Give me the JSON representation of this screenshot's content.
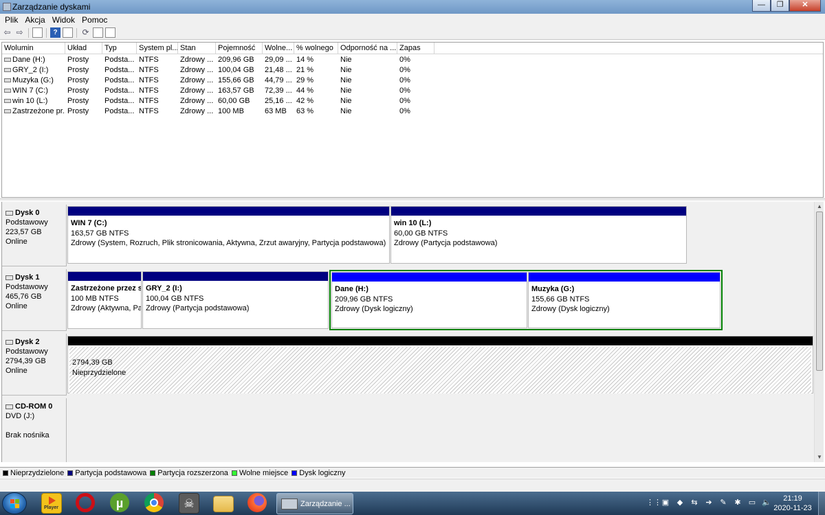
{
  "window": {
    "title": "Zarządzanie dyskami",
    "minimize": "—",
    "maximize": "❐",
    "close": "✕"
  },
  "menu": [
    "Plik",
    "Akcja",
    "Widok",
    "Pomoc"
  ],
  "toolbar": {
    "icons": [
      "back-icon",
      "forward-icon",
      "console-tree-icon",
      "help-icon",
      "list-view-icon",
      "refresh-icon",
      "properties-icon",
      "settings-icon"
    ],
    "back": "⇦",
    "forward": "⇨",
    "help": "?",
    "refresh": "⟳"
  },
  "columns": [
    "Wolumin",
    "Układ",
    "Typ",
    "System pl...",
    "Stan",
    "Pojemność",
    "Wolne...",
    "% wolnego",
    "Odporność na ...",
    "Zapas"
  ],
  "volumes": [
    [
      "Dane (H:)",
      "Prosty",
      "Podsta...",
      "NTFS",
      "Zdrowy ...",
      "209,96 GB",
      "29,09 ...",
      "14 %",
      "Nie",
      "0%"
    ],
    [
      "GRY_2 (I:)",
      "Prosty",
      "Podsta...",
      "NTFS",
      "Zdrowy ...",
      "100,04 GB",
      "21,48 ...",
      "21 %",
      "Nie",
      "0%"
    ],
    [
      "Muzyka (G:)",
      "Prosty",
      "Podsta...",
      "NTFS",
      "Zdrowy ...",
      "155,66 GB",
      "44,79 ...",
      "29 %",
      "Nie",
      "0%"
    ],
    [
      "WIN 7 (C:)",
      "Prosty",
      "Podsta...",
      "NTFS",
      "Zdrowy ...",
      "163,57 GB",
      "72,39 ...",
      "44 %",
      "Nie",
      "0%"
    ],
    [
      "win 10 (L:)",
      "Prosty",
      "Podsta...",
      "NTFS",
      "Zdrowy ...",
      "60,00 GB",
      "25,16 ...",
      "42 %",
      "Nie",
      "0%"
    ],
    [
      "Zastrzeżone pr...",
      "Prosty",
      "Podsta...",
      "NTFS",
      "Zdrowy ...",
      "100 MB",
      "63 MB",
      "63 %",
      "Nie",
      "0%"
    ]
  ],
  "disks": {
    "disk0": {
      "name": "Dysk 0",
      "type": "Podstawowy",
      "size": "223,57 GB",
      "status": "Online",
      "parts": [
        {
          "name": "WIN 7  (C:)",
          "size": "163,57 GB NTFS",
          "status": "Zdrowy (System, Rozruch, Plik stronicowania, Aktywna, Zrzut awaryjny, Partycja podstawowa)"
        },
        {
          "name": "win 10  (L:)",
          "size": "60,00 GB NTFS",
          "status": "Zdrowy (Partycja podstawowa)"
        }
      ]
    },
    "disk1": {
      "name": "Dysk 1",
      "type": "Podstawowy",
      "size": "465,76 GB",
      "status": "Online",
      "parts": [
        {
          "name": "Zastrzeżone przez s",
          "size": "100 MB NTFS",
          "status": "Zdrowy (Aktywna, Pa"
        },
        {
          "name": "GRY_2  (I:)",
          "size": "100,04 GB NTFS",
          "status": "Zdrowy (Partycja podstawowa)"
        },
        {
          "name": "Dane  (H:)",
          "size": "209,96 GB NTFS",
          "status": "Zdrowy (Dysk logiczny)"
        },
        {
          "name": "Muzyka  (G:)",
          "size": "155,66 GB NTFS",
          "status": "Zdrowy (Dysk logiczny)"
        }
      ]
    },
    "disk2": {
      "name": "Dysk 2",
      "type": "Podstawowy",
      "size": "2794,39 GB",
      "status": "Online",
      "parts": [
        {
          "size": "2794,39 GB",
          "status": "Nieprzydzielone"
        }
      ]
    },
    "cdrom0": {
      "name": "CD-ROM 0",
      "type": "DVD (J:)",
      "status": "Brak nośnika"
    }
  },
  "legend": [
    {
      "label": "Nieprzydzielone",
      "color": "#000000"
    },
    {
      "label": "Partycja podstawowa",
      "color": "#000080"
    },
    {
      "label": "Partycja rozszerzona",
      "color": "#008000"
    },
    {
      "label": "Wolne miejsce",
      "color": "#33ff33"
    },
    {
      "label": "Dysk logiczny",
      "color": "#0000ff"
    }
  ],
  "taskbar": {
    "apps": [
      "player-icon",
      "opera-icon",
      "utorrent-icon",
      "chrome-icon",
      "skull-app-icon",
      "explorer-folder-icon",
      "firefox-icon"
    ],
    "player_label": "Player",
    "utorrent_glyph": "µ",
    "skull_glyph": "☠",
    "active_task": "Zarządzanie ...",
    "tray_icons": [
      "tray-grid-icon",
      "nvidia-icon",
      "tray-red-icon",
      "usb-icon",
      "tray-arrow-icon",
      "tray-tool-icon",
      "avast-icon",
      "network-icon",
      "volume-icon"
    ],
    "tray_glyphs": [
      "⋮⋮",
      "▣",
      "◆",
      "⇆",
      "➔",
      "✎",
      "✱",
      "▭",
      "🔈"
    ],
    "time": "21:19",
    "date": "2020-11-23"
  }
}
